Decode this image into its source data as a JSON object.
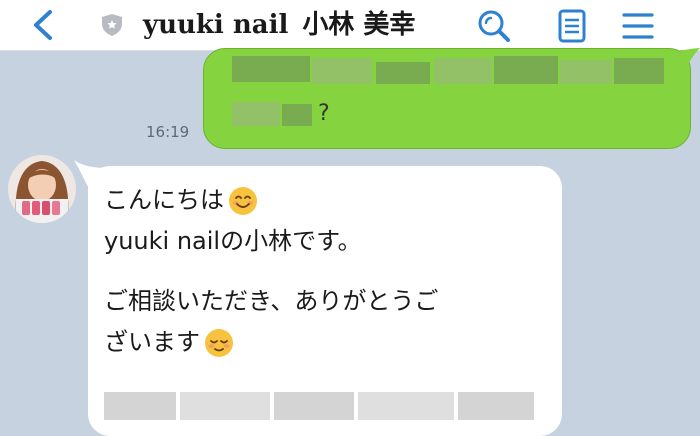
{
  "header": {
    "back_icon": "chevron-left-icon",
    "verified_icon": "shield-icon",
    "name": "yuuki nail",
    "person": "小林 美幸",
    "search_icon": "search-icon",
    "notes_icon": "notes-icon",
    "menu_icon": "menu-icon"
  },
  "messages": {
    "outgoing": {
      "visible_text": "?",
      "time": "16:19"
    },
    "incoming": {
      "line1": "こんにちは",
      "line2": "yuuki nailの小林です。",
      "line3": "ご相談いただき、ありがとうご",
      "line4": "ざいます",
      "emoji1": "smiling-face-icon",
      "emoji2": "relieved-face-icon"
    }
  },
  "colors": {
    "background": "#c6d2df",
    "outgoing_bubble": "#85d33f",
    "incoming_bubble": "#ffffff",
    "accent": "#2f80d1"
  }
}
